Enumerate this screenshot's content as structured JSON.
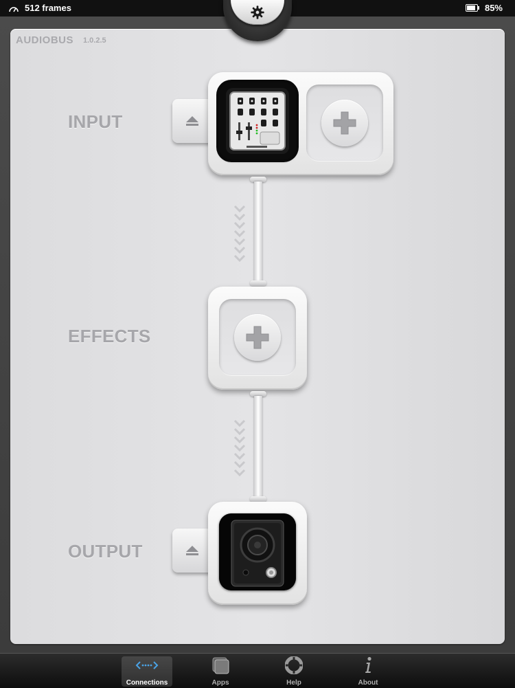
{
  "status_bar": {
    "left_text": "512 frames",
    "battery_percent": "85%",
    "icons": [
      "gauge-icon",
      "battery-icon"
    ]
  },
  "header": {
    "app_name": "AUDIOBUS",
    "version": "1.0.2.5",
    "settings_icon": "gear-icon"
  },
  "sections": {
    "input": {
      "label": "INPUT",
      "app_icon": "drum-machine-app-icon",
      "add_icon": "plus-icon",
      "eject_icon": "eject-icon"
    },
    "effects": {
      "label": "EFFECTS",
      "add_icon": "plus-icon"
    },
    "output": {
      "label": "OUTPUT",
      "app_icon": "speaker-app-icon",
      "eject_icon": "eject-icon"
    }
  },
  "tab_bar": {
    "active": "Connections",
    "tabs": [
      {
        "label": "Connections",
        "icon": "connections-icon"
      },
      {
        "label": "Apps",
        "icon": "apps-icon"
      },
      {
        "label": "Help",
        "icon": "lifebuoy-icon"
      },
      {
        "label": "About",
        "icon": "info-icon"
      }
    ]
  },
  "colors": {
    "accent_blue": "#4aa3e6",
    "panel_bg": "#e1e1e3",
    "label_gray": "#a6a6aa"
  }
}
